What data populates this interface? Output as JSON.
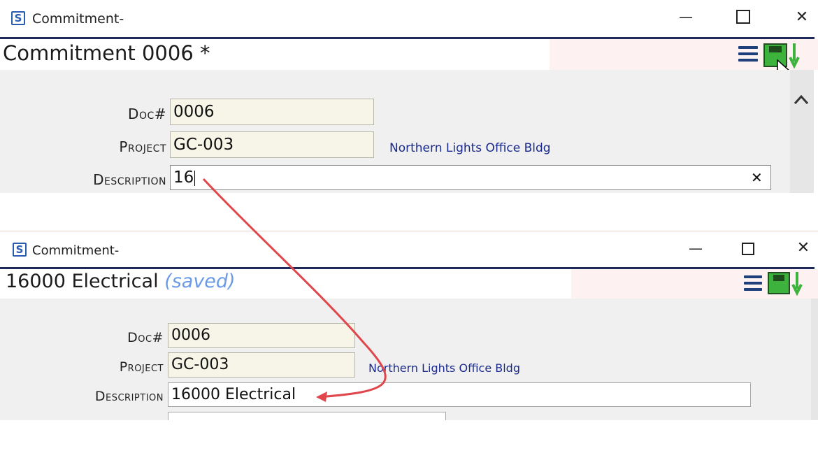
{
  "top_window": {
    "title": "Commitment-",
    "app_icon_letter": "S",
    "controls": {
      "minimize": "—",
      "maximize": "☐",
      "close": "✕"
    },
    "doc_title": "Commitment 0006 *",
    "fields": {
      "doc_label": "Doc#",
      "doc_value": "0006",
      "project_label": "Project",
      "project_value": "GC-003",
      "project_link": "Northern Lights Office Bldg",
      "description_label": "Description",
      "description_value": "16"
    },
    "clear_icon": "✕"
  },
  "bottom_window": {
    "title": "Commitment-",
    "app_icon_letter": "S",
    "controls": {
      "minimize": "—",
      "maximize": "☐",
      "close": "✕"
    },
    "doc_title": "16000 Electrical",
    "doc_status": "(saved)",
    "fields": {
      "doc_label": "Doc#",
      "doc_value": "0006",
      "project_label": "Project",
      "project_value": "GC-003",
      "project_link": "Northern Lights Office Bldg",
      "description_label": "Description",
      "description_value": "16000 Electrical"
    }
  },
  "icons": [
    "menu-icon",
    "save-icon",
    "arrow-down-icon",
    "clear-icon",
    "cursor-icon"
  ],
  "colors": {
    "accent_line": "#1f2a5c",
    "link": "#1a2a8c",
    "saved_status": "#6b9be6",
    "annotation_arrow": "#e0474c",
    "field_bg": "#f6f5e8"
  }
}
